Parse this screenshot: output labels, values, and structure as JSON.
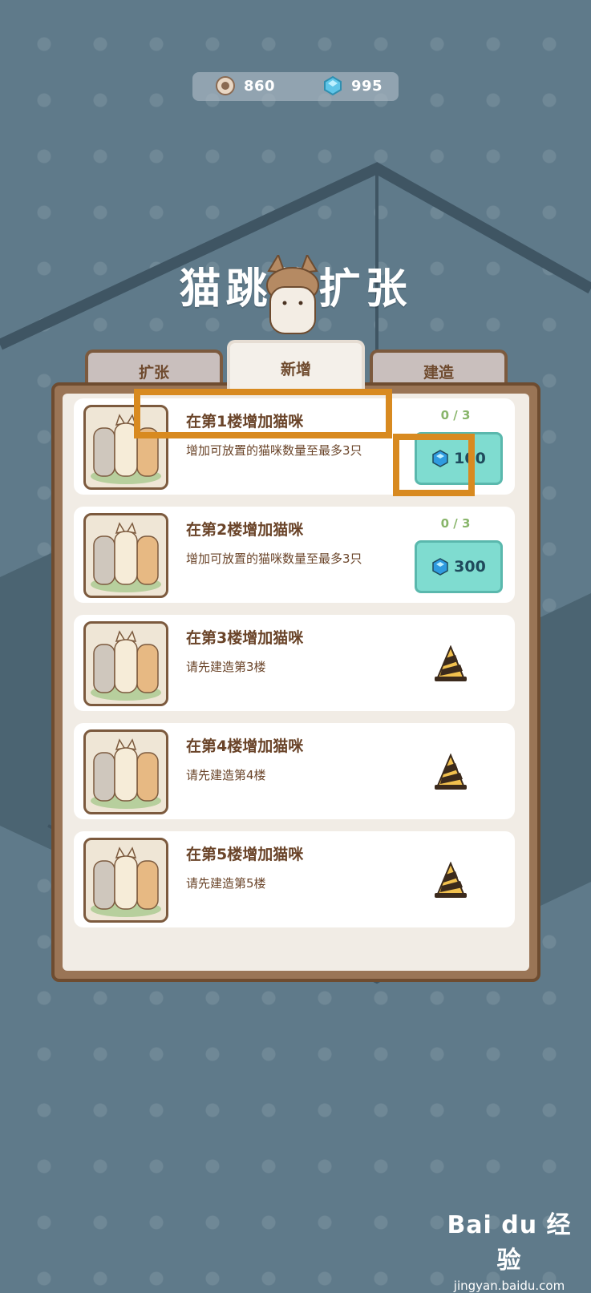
{
  "resources": [
    {
      "icon": "coin-icon",
      "value": "860"
    },
    {
      "icon": "gem-icon",
      "value": "995"
    }
  ],
  "title": "猫跳的扩张",
  "tabs": [
    {
      "label": "扩张",
      "active": false
    },
    {
      "label": "新增",
      "active": true
    },
    {
      "label": "建造",
      "active": false
    }
  ],
  "rows": [
    {
      "title": "在第1楼增加猫咪",
      "desc": "增加可放置的猫咪数量至最多3只",
      "progress": "0 / 3",
      "price": "100",
      "locked": false
    },
    {
      "title": "在第2楼增加猫咪",
      "desc": "增加可放置的猫咪数量至最多3只",
      "progress": "0 / 3",
      "price": "300",
      "locked": false
    },
    {
      "title": "在第3楼增加猫咪",
      "desc": "请先建造第3楼",
      "locked": true
    },
    {
      "title": "在第4楼增加猫咪",
      "desc": "请先建造第4楼",
      "locked": true
    },
    {
      "title": "在第5楼增加猫咪",
      "desc": "请先建造第5楼",
      "locked": true
    }
  ],
  "colors": {
    "background": "#5f7a8a",
    "panel_border": "#6e4c30",
    "text_brown": "#6a4429",
    "progress_green": "#88b56a",
    "button_teal": "#7fdcd0",
    "highlight_orange": "#d88a20"
  },
  "watermark": {
    "logo": "Bai du 经验",
    "url": "jingyan.baidu.com"
  }
}
